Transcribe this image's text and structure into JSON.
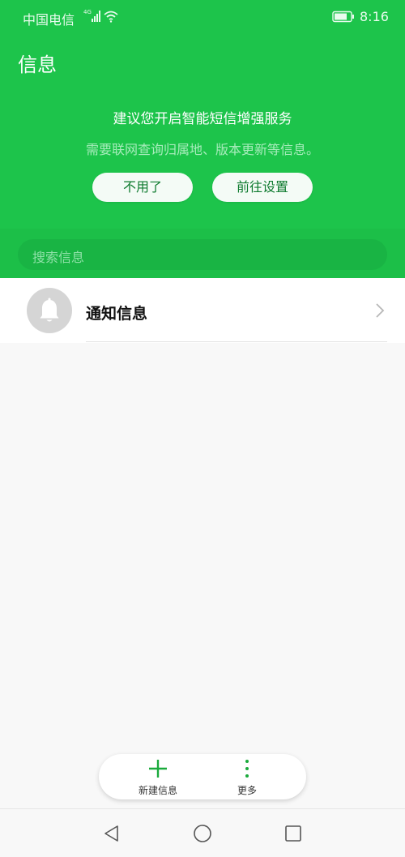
{
  "status_bar": {
    "carrier": "中国电信",
    "network": "4G",
    "time": "8:16"
  },
  "header": {
    "title": "信息"
  },
  "promo": {
    "title": "建议您开启智能短信增强服务",
    "subtitle": "需要联网查询归属地、版本更新等信息。",
    "decline_label": "不用了",
    "settings_label": "前往设置"
  },
  "search": {
    "placeholder": "搜索信息"
  },
  "conversations": [
    {
      "title": "通知信息",
      "icon": "bell-icon"
    }
  ],
  "bottom_bar": {
    "new_label": "新建信息",
    "more_label": "更多"
  },
  "colors": {
    "accent": "#1dc44b",
    "accent_dark": "#19b444",
    "icon_green": "#1aaa3c"
  }
}
